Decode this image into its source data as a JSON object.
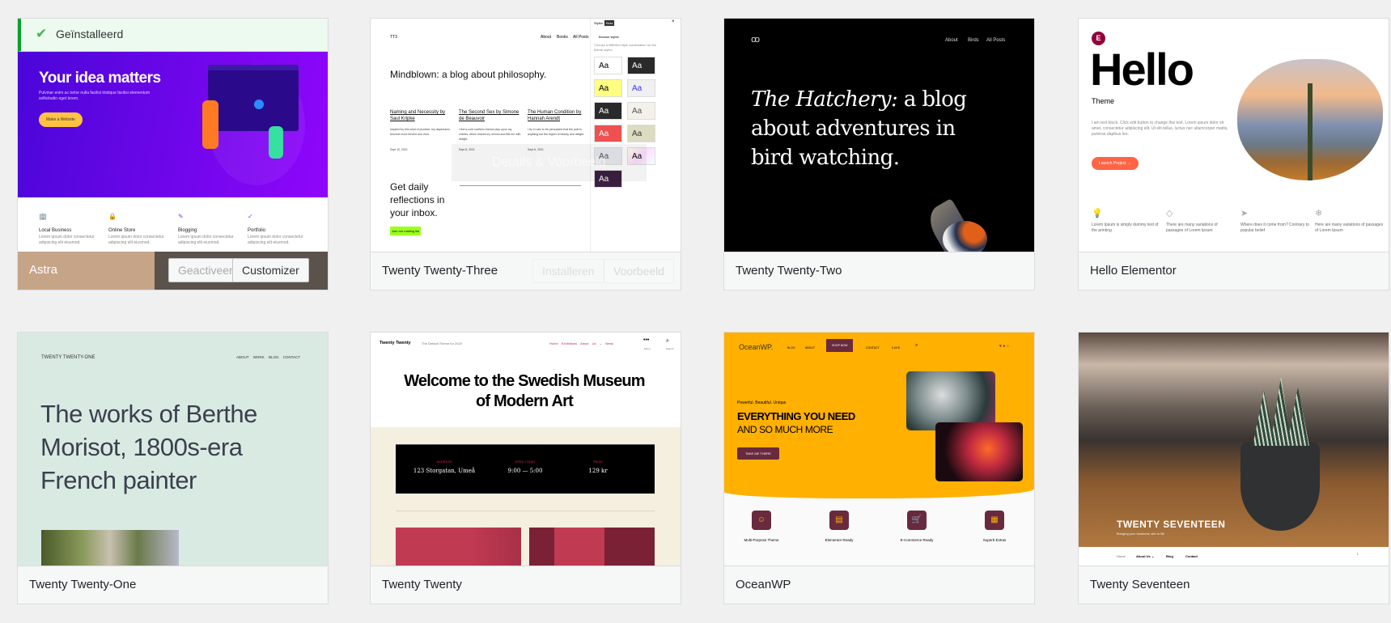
{
  "colors": {
    "page_bg": "#f0f0f1",
    "installed_green": "#00a32a",
    "astra_purple": "#7b0ff0",
    "oceanwp_orange": "#ffb000",
    "tt1_mint": "#d1e4dd",
    "twentytwenty_red": "#cd2653"
  },
  "themes": [
    {
      "name": "Astra",
      "installed_label": "Geïnstalleerd",
      "activated_label": "Geactiveerd",
      "customizer_label": "Customizer",
      "preview": {
        "title": "Your idea matters",
        "subtitle": "Pulvinar enim ac tortor nulla facilisi tristique facilisi elementum sollicitudin eget lorem.",
        "cta": "Make a Website",
        "features": [
          {
            "title": "Local Business",
            "text": "Lorem ipsum dolor consectetur adipiscing elit eiusmod."
          },
          {
            "title": "Online Store",
            "text": "Lorem ipsum dolor consectetur adipiscing elit eiusmod."
          },
          {
            "title": "Blogging",
            "text": "Lorem ipsum dolor consectetur adipiscing elit eiusmod."
          },
          {
            "title": "Portfolio",
            "text": "Lorem ipsum dolor consectetur adipiscing elit eiusmod."
          }
        ]
      }
    },
    {
      "name": "Twenty Twenty-Three",
      "install_label": "Installeren",
      "preview_label": "Voorbeeld",
      "details_overlay": "Details & Voorbeeld",
      "preview": {
        "logo": "TT3",
        "nav": [
          "About",
          "Books",
          "All Posts"
        ],
        "title": "Mindblown: a blog about philosophy.",
        "posts": [
          {
            "title": "Naming and Necessity by Saul Kripke",
            "text": "Inspired by this wind of promise, my daydreams become more fervent and vivid.",
            "date": "Sept 10, 2021"
          },
          {
            "title": "The Second Sex by Simone de Beauvoir",
            "text": "I feel a cold northern breeze play upon my cheeks, which braces my nerves and fills me with delight.",
            "date": "Sept 8, 2021"
          },
          {
            "title": "The Human Condition by Hannah Arendt",
            "text": "I try in vain to be persuaded that the pole is anything but the region of beauty and delight.",
            "date": "Sept 6, 2021"
          }
        ],
        "newsletter": "Get daily reflections in your inbox.",
        "newsletter_button": "Join our mailing list",
        "panel": {
          "title": "Styles",
          "badge": "Beta",
          "back": "Browse styles",
          "desc": "Choose a different style combination for the theme styles",
          "swatch": "Aa"
        }
      }
    },
    {
      "name": "Twenty Twenty-Two",
      "preview": {
        "nav": [
          "About",
          "Birds",
          "All Posts"
        ],
        "title_italic": "The Hatchery:",
        "title_rest": "a blog about adventures in bird watching."
      }
    },
    {
      "name": "Hello Elementor",
      "preview": {
        "title": "Hello",
        "subtitle": "Theme",
        "text": "I am text block. Click edit button to change this text. Lorem ipsum dolor sit amet, consectetur adipiscing elit. Ut elit tellus, luctus nec ullamcorper mattis, pulvinar dapibus leo.",
        "cta": "Launch Project →",
        "features": [
          "Lorem Ipsum is simply dummy text of the printing",
          "There are many variations of passages of Lorem Ipsum",
          "Where does it come from? Contrary to popular belief",
          "Here are many variations of passages of Lorem Ipsum"
        ]
      }
    },
    {
      "name": "Twenty Twenty-One",
      "preview": {
        "logo": "TWENTY TWENTY-ONE",
        "nav": [
          "ABOUT",
          "WORK",
          "BLOG",
          "CONTACT"
        ],
        "title": "The works of Berthe Morisot, 1800s-era French painter"
      }
    },
    {
      "name": "Twenty Twenty",
      "preview": {
        "logo": "Twenty Twenty",
        "tagline": "The Default Theme for 2020",
        "nav": [
          "Home",
          "Exhibitions",
          "About Us ⌄",
          "News"
        ],
        "menu": "Menu",
        "search": "Search",
        "title": "Welcome to the Swedish Museum of Modern Art",
        "info": [
          {
            "label": "ADDRESS",
            "value": "123 Storgatan, Umeå"
          },
          {
            "label": "OPEN TODAY",
            "value": "9:00 — 5:00"
          },
          {
            "label": "PRICE",
            "value": "129 kr"
          }
        ]
      }
    },
    {
      "name": "OceanWP",
      "preview": {
        "logo": "OceanWP.",
        "nav": [
          "BLOG",
          "ABOUT",
          "SHOP NOW",
          "CONTACT",
          "0,00 $"
        ],
        "kicker": "Powerful. Beautiful. Unique",
        "title1": "EVERYTHING YOU NEED",
        "title2": "AND SO MUCH MORE",
        "cta": "TAKE ME THERE",
        "features": [
          "Multi-Purpose Theme",
          "Elementor Ready",
          "E-Commerce Ready",
          "Superb Extras"
        ]
      }
    },
    {
      "name": "Twenty Seventeen",
      "preview": {
        "title": "TWENTY SEVENTEEN",
        "tagline": "Bringing your business' site to life",
        "nav": [
          "Home",
          "About Us ⌄",
          "Blog",
          "Contact"
        ]
      }
    }
  ]
}
